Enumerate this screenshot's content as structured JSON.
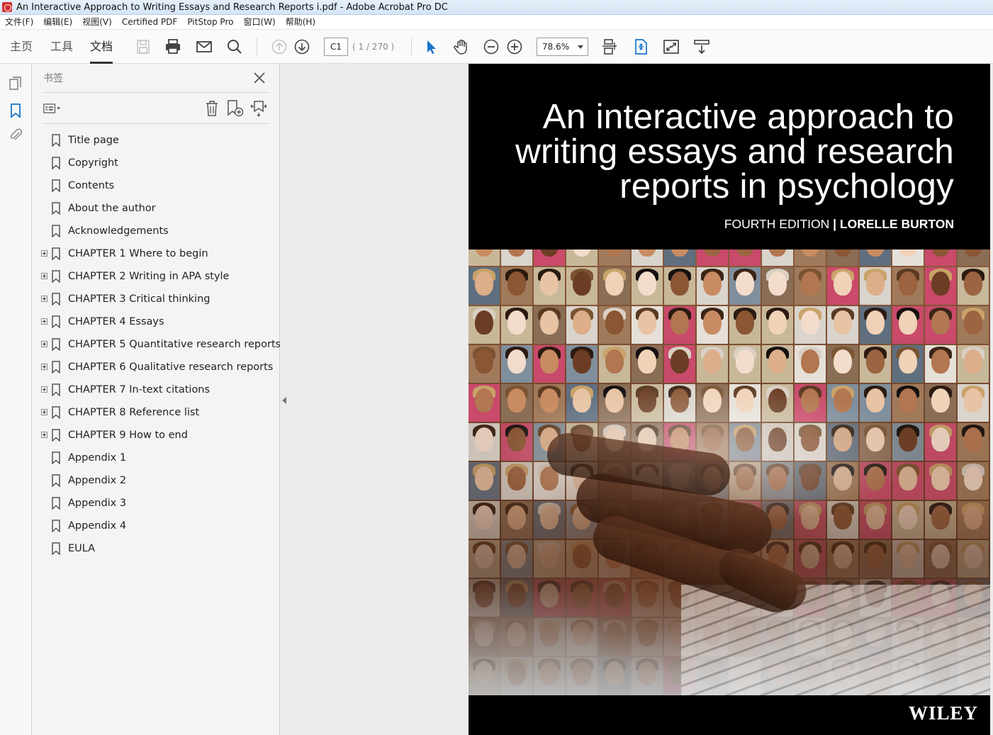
{
  "window": {
    "title": "An Interactive Approach to Writing Essays and Research Reports i.pdf - Adobe Acrobat Pro DC"
  },
  "menu": [
    "文件(F)",
    "编辑(E)",
    "视图(V)",
    "Certified PDF",
    "PitStop Pro",
    "窗口(W)",
    "帮助(H)"
  ],
  "tabs": {
    "home": "主页",
    "tools": "工具",
    "document": "文档"
  },
  "toolbar": {
    "page_current": "C1",
    "page_total": "( 1 / 270 )",
    "zoom": "78.6%"
  },
  "bookmarks_panel": {
    "title": "书签",
    "items": [
      {
        "label": "Title page",
        "expandable": false
      },
      {
        "label": "Copyright",
        "expandable": false
      },
      {
        "label": "Contents",
        "expandable": false
      },
      {
        "label": "About the author",
        "expandable": false
      },
      {
        "label": "Acknowledgements",
        "expandable": false
      },
      {
        "label": "CHAPTER 1 Where to begin",
        "expandable": true
      },
      {
        "label": "CHAPTER 2 Writing in APA style",
        "expandable": true
      },
      {
        "label": "CHAPTER 3 Critical thinking",
        "expandable": true
      },
      {
        "label": "CHAPTER 4 Essays",
        "expandable": true
      },
      {
        "label": "CHAPTER 5 Quantitative research reports",
        "expandable": true
      },
      {
        "label": "CHAPTER 6 Qualitative research reports",
        "expandable": true
      },
      {
        "label": "CHAPTER 7 In-text citations",
        "expandable": true
      },
      {
        "label": "CHAPTER 8 Reference list",
        "expandable": true
      },
      {
        "label": "CHAPTER 9 How to end",
        "expandable": true
      },
      {
        "label": "Appendix 1",
        "expandable": false
      },
      {
        "label": "Appendix 2",
        "expandable": false
      },
      {
        "label": "Appendix 3",
        "expandable": false
      },
      {
        "label": "Appendix 4",
        "expandable": false
      },
      {
        "label": "EULA",
        "expandable": false
      }
    ]
  },
  "cover": {
    "title_lines": [
      "An interactive approach to",
      "writing essays and research",
      "reports in psychology"
    ],
    "edition": "FOURTH EDITION",
    "divider": "|",
    "author": "LORELLE BURTON",
    "publisher": "WILEY"
  },
  "colors": {
    "accent_blue": "#1a73c9",
    "panel_bg": "#f4f4f4",
    "viewer_bg": "#ececec"
  }
}
